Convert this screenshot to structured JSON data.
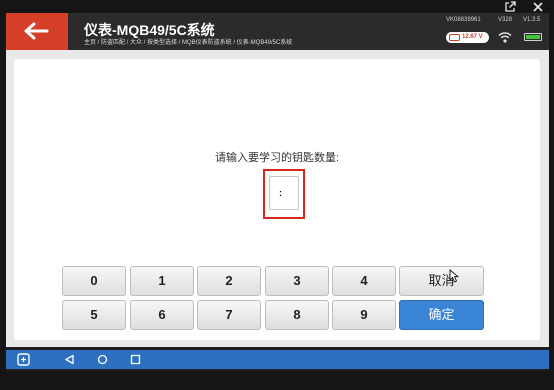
{
  "header": {
    "title": "仪表-MQB49/5C系统",
    "breadcrumb": "主页 / 防盗匹配 / 大众 / 按类型选择 / MQB仪表防盗系统 / 仪表-MQB49/5C系统",
    "vin": "VK08839961",
    "version_a": "V328",
    "version_b": "V1.3.5",
    "voltage": "12.67 V",
    "back_icon": "arrow-left-icon",
    "accent_color": "#d53f27"
  },
  "prompt": {
    "label": "请输入要学习的钥匙数量:",
    "input_value": ":"
  },
  "keypad": {
    "row1": [
      "0",
      "1",
      "2",
      "3",
      "4"
    ],
    "row2": [
      "5",
      "6",
      "7",
      "8",
      "9"
    ],
    "cancel": "取消",
    "confirm": "确定",
    "confirm_color": "#3a84d6"
  },
  "navbar": {
    "icons": [
      "app-switch-icon",
      "back-triangle-icon",
      "home-circle-icon",
      "recents-square-icon"
    ],
    "color": "#2d6fc0"
  }
}
